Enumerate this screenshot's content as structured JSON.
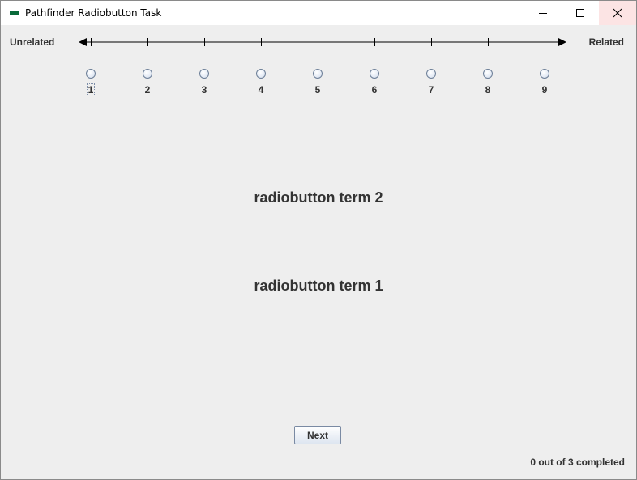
{
  "window": {
    "title": "Pathfinder Radiobutton Task",
    "controls": [
      "minimize-icon",
      "maximize-icon",
      "close-icon"
    ]
  },
  "scale": {
    "left_label": "Unrelated",
    "right_label": "Related",
    "options": [
      "1",
      "2",
      "3",
      "4",
      "5",
      "6",
      "7",
      "8",
      "9"
    ],
    "selected": null,
    "focused_option": "1"
  },
  "terms": {
    "top": "radiobutton term 2",
    "bottom": "radiobutton term 1"
  },
  "actions": {
    "next_label": "Next"
  },
  "status": {
    "progress_text": "0 out of 3 completed",
    "completed": 0,
    "total": 3
  }
}
